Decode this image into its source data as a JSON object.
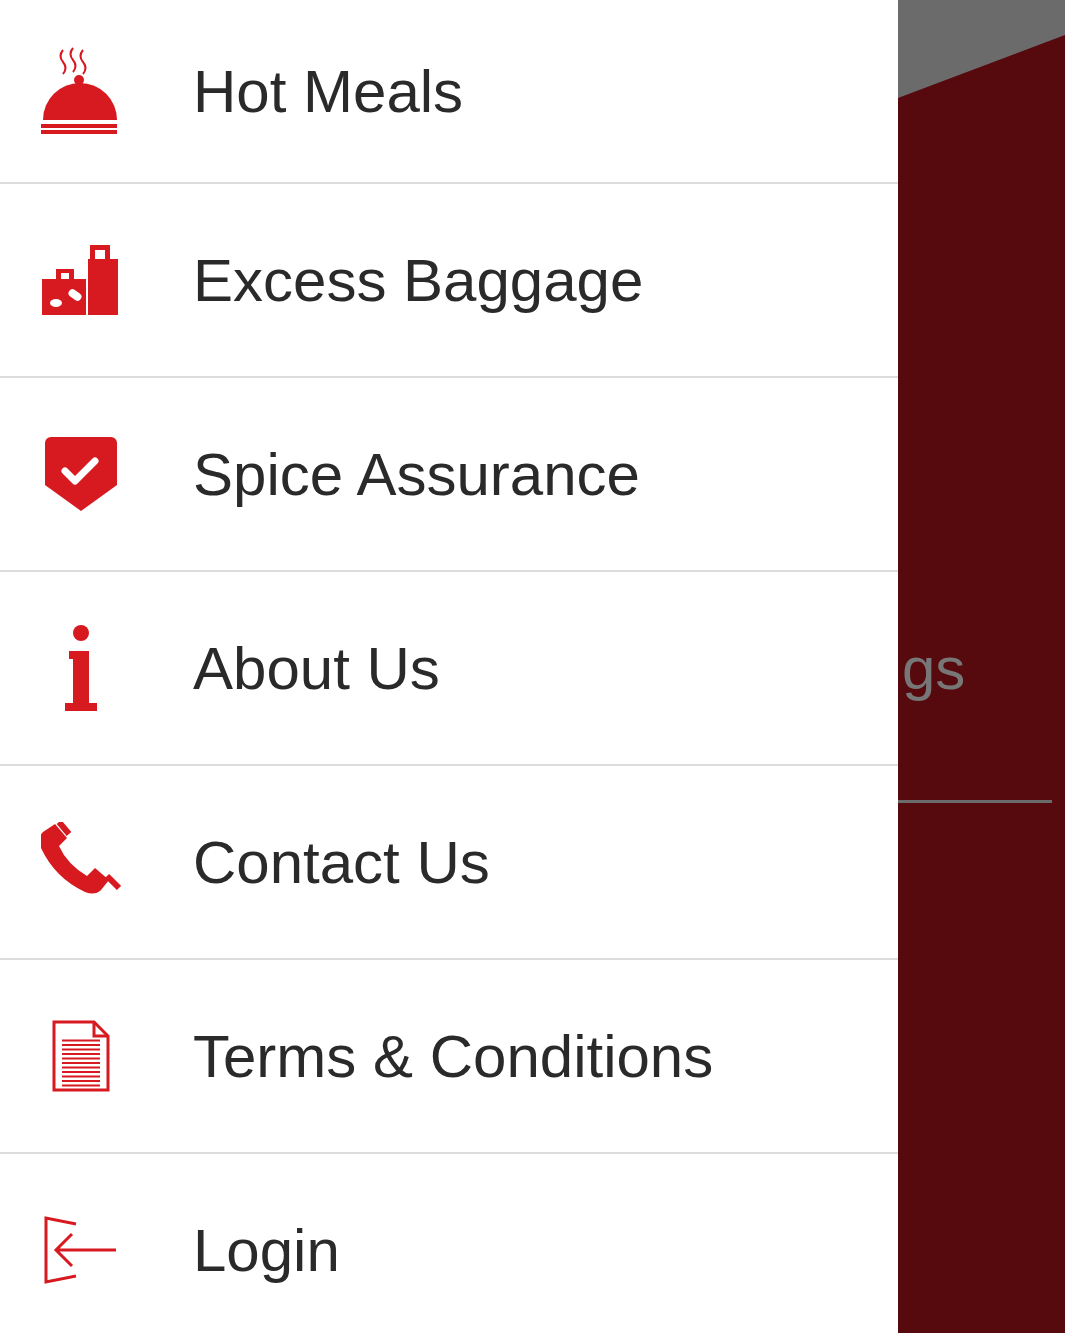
{
  "menu": [
    {
      "label": "Hot Meals",
      "kind": "meals"
    },
    {
      "label": "Excess Baggage",
      "kind": "baggage"
    },
    {
      "label": "Spice Assurance",
      "kind": "assurance"
    },
    {
      "label": "About Us",
      "kind": "info"
    },
    {
      "label": "Contact Us",
      "kind": "phone"
    },
    {
      "label": "Terms & Conditions",
      "kind": "document"
    },
    {
      "label": "Login",
      "kind": "login"
    }
  ],
  "background": {
    "partial_text": "gs"
  }
}
